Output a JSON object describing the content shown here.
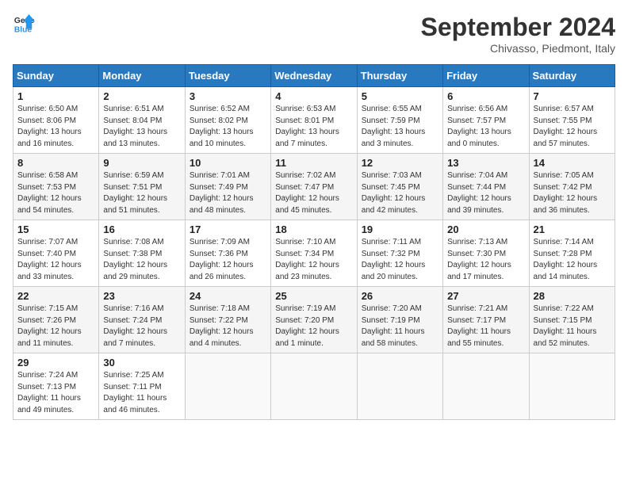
{
  "logo": {
    "line1": "General",
    "line2": "Blue"
  },
  "title": "September 2024",
  "location": "Chivasso, Piedmont, Italy",
  "days_of_week": [
    "Sunday",
    "Monday",
    "Tuesday",
    "Wednesday",
    "Thursday",
    "Friday",
    "Saturday"
  ],
  "weeks": [
    [
      {
        "day": "1",
        "info": "Sunrise: 6:50 AM\nSunset: 8:06 PM\nDaylight: 13 hours\nand 16 minutes."
      },
      {
        "day": "2",
        "info": "Sunrise: 6:51 AM\nSunset: 8:04 PM\nDaylight: 13 hours\nand 13 minutes."
      },
      {
        "day": "3",
        "info": "Sunrise: 6:52 AM\nSunset: 8:02 PM\nDaylight: 13 hours\nand 10 minutes."
      },
      {
        "day": "4",
        "info": "Sunrise: 6:53 AM\nSunset: 8:01 PM\nDaylight: 13 hours\nand 7 minutes."
      },
      {
        "day": "5",
        "info": "Sunrise: 6:55 AM\nSunset: 7:59 PM\nDaylight: 13 hours\nand 3 minutes."
      },
      {
        "day": "6",
        "info": "Sunrise: 6:56 AM\nSunset: 7:57 PM\nDaylight: 13 hours\nand 0 minutes."
      },
      {
        "day": "7",
        "info": "Sunrise: 6:57 AM\nSunset: 7:55 PM\nDaylight: 12 hours\nand 57 minutes."
      }
    ],
    [
      {
        "day": "8",
        "info": "Sunrise: 6:58 AM\nSunset: 7:53 PM\nDaylight: 12 hours\nand 54 minutes."
      },
      {
        "day": "9",
        "info": "Sunrise: 6:59 AM\nSunset: 7:51 PM\nDaylight: 12 hours\nand 51 minutes."
      },
      {
        "day": "10",
        "info": "Sunrise: 7:01 AM\nSunset: 7:49 PM\nDaylight: 12 hours\nand 48 minutes."
      },
      {
        "day": "11",
        "info": "Sunrise: 7:02 AM\nSunset: 7:47 PM\nDaylight: 12 hours\nand 45 minutes."
      },
      {
        "day": "12",
        "info": "Sunrise: 7:03 AM\nSunset: 7:45 PM\nDaylight: 12 hours\nand 42 minutes."
      },
      {
        "day": "13",
        "info": "Sunrise: 7:04 AM\nSunset: 7:44 PM\nDaylight: 12 hours\nand 39 minutes."
      },
      {
        "day": "14",
        "info": "Sunrise: 7:05 AM\nSunset: 7:42 PM\nDaylight: 12 hours\nand 36 minutes."
      }
    ],
    [
      {
        "day": "15",
        "info": "Sunrise: 7:07 AM\nSunset: 7:40 PM\nDaylight: 12 hours\nand 33 minutes."
      },
      {
        "day": "16",
        "info": "Sunrise: 7:08 AM\nSunset: 7:38 PM\nDaylight: 12 hours\nand 29 minutes."
      },
      {
        "day": "17",
        "info": "Sunrise: 7:09 AM\nSunset: 7:36 PM\nDaylight: 12 hours\nand 26 minutes."
      },
      {
        "day": "18",
        "info": "Sunrise: 7:10 AM\nSunset: 7:34 PM\nDaylight: 12 hours\nand 23 minutes."
      },
      {
        "day": "19",
        "info": "Sunrise: 7:11 AM\nSunset: 7:32 PM\nDaylight: 12 hours\nand 20 minutes."
      },
      {
        "day": "20",
        "info": "Sunrise: 7:13 AM\nSunset: 7:30 PM\nDaylight: 12 hours\nand 17 minutes."
      },
      {
        "day": "21",
        "info": "Sunrise: 7:14 AM\nSunset: 7:28 PM\nDaylight: 12 hours\nand 14 minutes."
      }
    ],
    [
      {
        "day": "22",
        "info": "Sunrise: 7:15 AM\nSunset: 7:26 PM\nDaylight: 12 hours\nand 11 minutes."
      },
      {
        "day": "23",
        "info": "Sunrise: 7:16 AM\nSunset: 7:24 PM\nDaylight: 12 hours\nand 7 minutes."
      },
      {
        "day": "24",
        "info": "Sunrise: 7:18 AM\nSunset: 7:22 PM\nDaylight: 12 hours\nand 4 minutes."
      },
      {
        "day": "25",
        "info": "Sunrise: 7:19 AM\nSunset: 7:20 PM\nDaylight: 12 hours\nand 1 minute."
      },
      {
        "day": "26",
        "info": "Sunrise: 7:20 AM\nSunset: 7:19 PM\nDaylight: 11 hours\nand 58 minutes."
      },
      {
        "day": "27",
        "info": "Sunrise: 7:21 AM\nSunset: 7:17 PM\nDaylight: 11 hours\nand 55 minutes."
      },
      {
        "day": "28",
        "info": "Sunrise: 7:22 AM\nSunset: 7:15 PM\nDaylight: 11 hours\nand 52 minutes."
      }
    ],
    [
      {
        "day": "29",
        "info": "Sunrise: 7:24 AM\nSunset: 7:13 PM\nDaylight: 11 hours\nand 49 minutes."
      },
      {
        "day": "30",
        "info": "Sunrise: 7:25 AM\nSunset: 7:11 PM\nDaylight: 11 hours\nand 46 minutes."
      },
      {
        "day": "",
        "info": ""
      },
      {
        "day": "",
        "info": ""
      },
      {
        "day": "",
        "info": ""
      },
      {
        "day": "",
        "info": ""
      },
      {
        "day": "",
        "info": ""
      }
    ]
  ]
}
